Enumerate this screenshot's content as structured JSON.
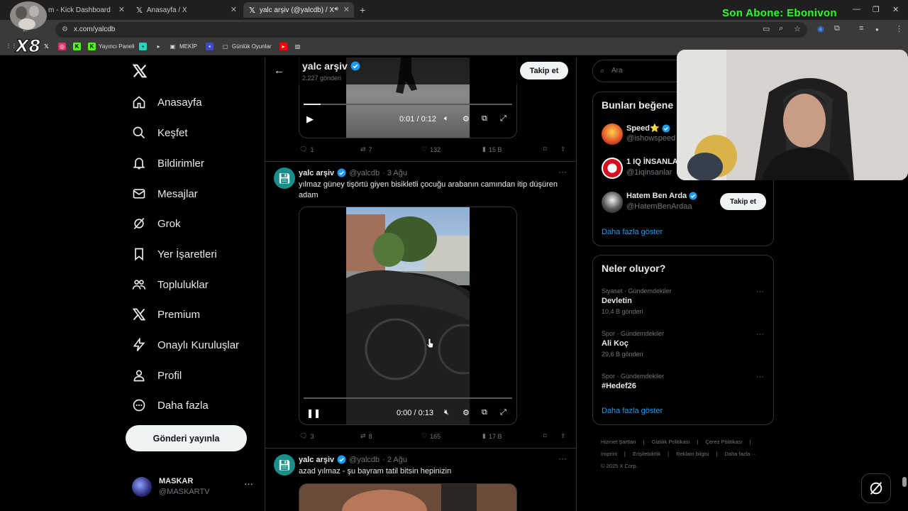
{
  "browser": {
    "tabs": [
      {
        "label": "m - Kick Dashboard",
        "favicon": "kick-logo"
      },
      {
        "label": "Anasayfa / X",
        "favicon": "x-logo"
      },
      {
        "label": "yalc arşiv (@yalcdb) / X",
        "favicon": "x-logo",
        "active": true
      }
    ],
    "url": "x.com/yalcdb",
    "bookmarks": [
      "Yayıncı Paneli",
      "MEKİP",
      "Günlük Oyunlar"
    ],
    "stream_overlay": "Son Abone: Ebonivon",
    "stream_logo": "X8"
  },
  "sidebar": {
    "items": [
      {
        "label": "Anasayfa",
        "icon": "home-icon"
      },
      {
        "label": "Keşfet",
        "icon": "search-icon"
      },
      {
        "label": "Bildirimler",
        "icon": "bell-icon"
      },
      {
        "label": "Mesajlar",
        "icon": "mail-icon"
      },
      {
        "label": "Grok",
        "icon": "grok-icon"
      },
      {
        "label": "Yer İşaretleri",
        "icon": "bookmark-icon"
      },
      {
        "label": "Topluluklar",
        "icon": "people-icon"
      },
      {
        "label": "Premium",
        "icon": "x-logo-icon"
      },
      {
        "label": "Onaylı Kuruluşlar",
        "icon": "lightning-icon"
      },
      {
        "label": "Profil",
        "icon": "person-icon"
      },
      {
        "label": "Daha fazla",
        "icon": "more-circle-icon"
      }
    ],
    "post_button": "Gönderi yayınla",
    "account": {
      "name": "MASKAR",
      "handle": "@MASKARTV"
    }
  },
  "profile_header": {
    "name": "yalc arşiv",
    "posts": "2.227 gönderi",
    "follow": "Takip et"
  },
  "tweets": [
    {
      "video": {
        "time": "0:01 / 0:12",
        "progress": 0.08
      },
      "stats": {
        "replies": "1",
        "reposts": "7",
        "likes": "132",
        "views": "15 B"
      }
    },
    {
      "name": "yalc arşiv",
      "handle": "@yalcdb",
      "date": "· 3 Ağu",
      "text": "yılmaz güney tişörtü giyen bisikletli çocuğu arabanın camından itip düşüren adam",
      "video": {
        "time": "0:00 / 0:13",
        "progress": 0.0
      },
      "stats": {
        "replies": "3",
        "reposts": "8",
        "likes": "165",
        "views": "17 B"
      }
    },
    {
      "name": "yalc arşiv",
      "handle": "@yalcdb",
      "date": "· 2 Ağu",
      "text": "azad yılmaz - şu bayram tatil bitsin hepinizin"
    }
  ],
  "right": {
    "search_placeholder": "Ara",
    "who_to_follow": {
      "title": "Bunları beğene",
      "users": [
        {
          "name": "Speed⭐",
          "handle": "@ishowspeed"
        },
        {
          "name": "1 IQ İNSANLA",
          "handle": "@1iqinsanlar"
        },
        {
          "name": "Hatem Ben Arda",
          "handle": "@HatemBenArdaa",
          "follow": "Takip et"
        }
      ],
      "show_more": "Daha fazla göster"
    },
    "trends": {
      "title": "Neler oluyor?",
      "items": [
        {
          "category": "Siyaset · Gündemdekiler",
          "name": "Devletin",
          "count": "10,4 B gönderi"
        },
        {
          "category": "Spor · Gündemdekiler",
          "name": "Ali Koç",
          "count": "29,6 B gönderi"
        },
        {
          "category": "Spor · Gündemdekiler",
          "name": "#Hedef26",
          "count": ""
        }
      ],
      "show_more": "Daha fazla göster"
    },
    "footer": [
      "Hizmet Şartları",
      "Gizlilik Politikası",
      "Çerez Politikası",
      "Imprint",
      "Erişilebilirlik",
      "Reklam bilgisi",
      "Daha fazla ···",
      "© 2025 X Corp."
    ]
  },
  "colors": {
    "accent": "#1d9bf0",
    "overlay_green": "#2bff2b",
    "background": "#000000"
  }
}
